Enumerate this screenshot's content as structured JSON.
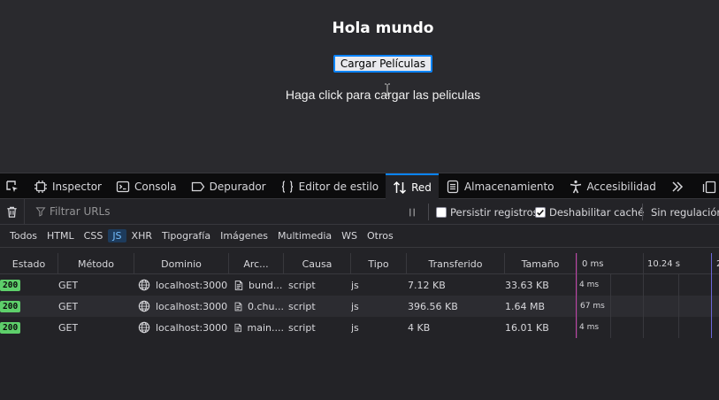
{
  "page": {
    "title": "Hola mundo",
    "button_label": "Cargar Películas",
    "message": "Haga click para cargar las peliculas"
  },
  "devtools": {
    "tabs": [
      {
        "label": "Inspector",
        "icon": "inspector-icon"
      },
      {
        "label": "Consola",
        "icon": "console-icon"
      },
      {
        "label": "Depurador",
        "icon": "debugger-icon"
      },
      {
        "label": "Editor de estilo",
        "icon": "style-editor-icon"
      },
      {
        "label": "Red",
        "icon": "network-icon"
      },
      {
        "label": "Almacenamiento",
        "icon": "storage-icon"
      },
      {
        "label": "Accesibilidad",
        "icon": "accessibility-icon"
      }
    ],
    "selected_tab": "Red",
    "filter": {
      "url_placeholder": "Filtrar URLs",
      "persist_label": "Persistir registros",
      "persist_checked": false,
      "disable_cache_label": "Deshabilitar caché",
      "disable_cache_checked": true,
      "throttle_label": "Sin regulación"
    },
    "types": [
      "Todos",
      "HTML",
      "CSS",
      "JS",
      "XHR",
      "Tipografía",
      "Imágenes",
      "Multimedia",
      "WS",
      "Otros"
    ],
    "active_type": "JS",
    "columns": {
      "status": "Estado",
      "method": "Método",
      "domain": "Dominio",
      "file": "Arc...",
      "cause": "Causa",
      "type": "Tipo",
      "transferred": "Transferido",
      "size": "Tamaño"
    },
    "timeline_ticks": [
      "0 ms",
      "10.24 s",
      "2"
    ],
    "requests": [
      {
        "status": "200",
        "method": "GET",
        "domain": "localhost:3000",
        "file": "bund...",
        "cause": "script",
        "type": "js",
        "transferred": "7.12 KB",
        "size": "33.63 KB",
        "time": "4 ms"
      },
      {
        "status": "200",
        "method": "GET",
        "domain": "localhost:3000",
        "file": "0.chu...",
        "cause": "script",
        "type": "js",
        "transferred": "396.56 KB",
        "size": "1.64 MB",
        "time": "67 ms"
      },
      {
        "status": "200",
        "method": "GET",
        "domain": "localhost:3000",
        "file": "main....",
        "cause": "script",
        "type": "js",
        "transferred": "4 KB",
        "size": "16.01 KB",
        "time": "4 ms"
      }
    ]
  }
}
